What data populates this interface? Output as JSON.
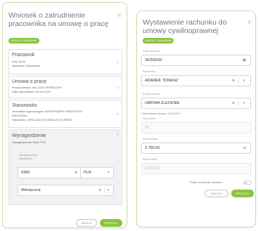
{
  "left_form": {
    "title": "Wniosek o zatrudnienie pracownika na umowę o pracę",
    "badge": "ODDAJ | ZAŁĄCZNIK",
    "pracownik": {
      "title": "Pracownik",
      "lines": [
        "Imię: Anna",
        "Nazwisko: Malinowska"
      ]
    },
    "umowa": {
      "title": "Umowa o pracę",
      "lines": [
        "Rodzaj umowy: NA CZAS OKREŚLONY",
        "Data zatrudnienia: 01 kwi 2020"
      ]
    },
    "stanowisko": {
      "title": "Stanowisko",
      "lines": [
        "Jednostka organizacyjna: DEPARTAMENT KREDYTÓW",
        "WROCŁAW",
        "Stanowisko: SPECJALISTA OBSŁUGI KLIENTA"
      ]
    },
    "wynagrodzenie": {
      "title": "Wynagrodzenie",
      "summary": "Wynagrodzenie: 5360 PLN",
      "amount_label": [
        "Wynagrodzenie",
        "zasadnicze"
      ],
      "amount_value": "5360",
      "currency": "PLN",
      "period": "Miesięczna"
    },
    "cancel_label": "ANULUJ",
    "next_label": "PRZEŚLIJ"
  },
  "right_form": {
    "title": "Wystawienie rachunku do umowy cywilnoprawnej",
    "badge": "UMOWY | ZAŁĄCZNIK",
    "date_label": "Data rachunku",
    "date_value": "30/3/2020",
    "employee_label": "Pracownik",
    "employee_value": "ADAMEK TOMASZ",
    "contract_label": "Rodzaj umowy",
    "contract_value": "UMOWA ZLECENIE",
    "period_text": "Czas trwania umowy: 14 lis 2017 -",
    "tax_label": "% kosztów",
    "tax_value": "20",
    "gross_label": "Kwota brutto",
    "gross_value": "3 780,00",
    "net_label": "Kwota netto",
    "net_value": "2 610,21",
    "toggle_label": "Pokaż rozliczenie rachunku",
    "cancel_label": "ANULUJ",
    "submit_label": "PRZEŚLIJ"
  }
}
